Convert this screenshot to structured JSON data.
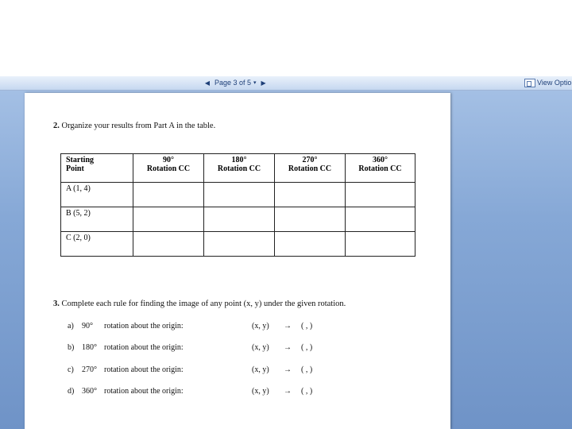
{
  "toolbar": {
    "prev_glyph": "◀",
    "page_label": "Page 3 of 5",
    "dropdown_glyph": "▾",
    "next_glyph": "▶",
    "view_options": "View Optio"
  },
  "document": {
    "q2": {
      "number": "2.",
      "text": "Organize your results from Part A in the table."
    },
    "table": {
      "headers": [
        {
          "line1": "Starting",
          "line2": "Point"
        },
        {
          "line1": "90°",
          "line2": "Rotation CC"
        },
        {
          "line1": "180°",
          "line2": "Rotation CC"
        },
        {
          "line1": "270°",
          "line2": "Rotation CC"
        },
        {
          "line1": "360°",
          "line2": "Rotation CC"
        }
      ],
      "rows": [
        {
          "point": "A (1, 4)"
        },
        {
          "point": "B (5, 2)"
        },
        {
          "point": "C (2, 0)"
        }
      ]
    },
    "q3": {
      "number": "3.",
      "text": "Complete each rule for finding the image of any point (x, y) under the given rotation."
    },
    "rules": [
      {
        "label": "a)",
        "angle": "90°",
        "text": "rotation about the origin:",
        "input": "(x, y)",
        "arrow": "→",
        "output": "(        ,        )"
      },
      {
        "label": "b)",
        "angle": "180°",
        "text": "rotation about the origin:",
        "input": "(x, y)",
        "arrow": "→",
        "output": "(        ,        )"
      },
      {
        "label": "c)",
        "angle": "270°",
        "text": "rotation about the origin:",
        "input": "(x, y)",
        "arrow": "→",
        "output": "(        ,        )"
      },
      {
        "label": "d)",
        "angle": "360°",
        "text": "rotation about the origin:",
        "input": "(x, y)",
        "arrow": "→",
        "output": "(        ,        )"
      }
    ]
  }
}
